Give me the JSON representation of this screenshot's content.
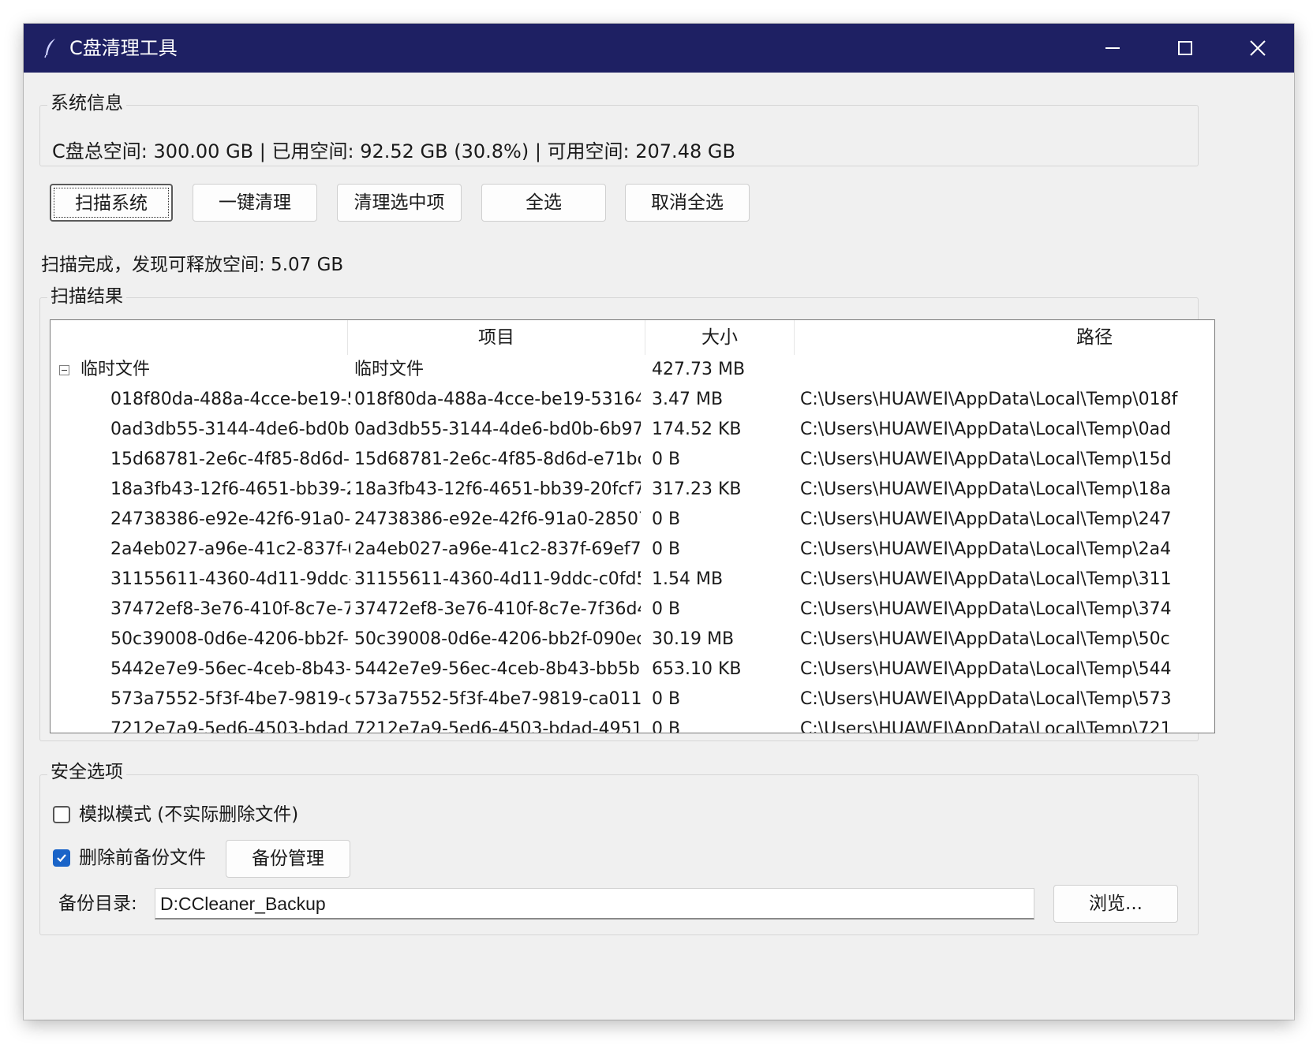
{
  "window": {
    "title": "C盘清理工具",
    "accent": "#1e2063"
  },
  "system_info": {
    "group_label": "系统信息",
    "text": "C盘总空间: 300.00 GB | 已用空间: 92.52 GB (30.8%) | 可用空间: 207.48 GB"
  },
  "toolbar": {
    "scan": "扫描系统",
    "one_click_clean": "一键清理",
    "clean_selected": "清理选中项",
    "select_all": "全选",
    "deselect_all": "取消全选"
  },
  "status": "扫描完成，发现可释放空间: 5.07 GB",
  "results": {
    "group_label": "扫描结果",
    "columns": [
      "",
      "项目",
      "大小",
      "路径"
    ],
    "parent": {
      "name": "临时文件",
      "item": "临时文件",
      "size": "427.73 MB",
      "path": ""
    },
    "rows": [
      {
        "name": "018f80da-488a-4cce-be19-5",
        "item": "018f80da-488a-4cce-be19-53164",
        "size": "3.47 MB",
        "path": "C:\\Users\\HUAWEI\\AppData\\Local\\Temp\\018f"
      },
      {
        "name": "0ad3db55-3144-4de6-bd0b",
        "item": "0ad3db55-3144-4de6-bd0b-6b97",
        "size": "174.52 KB",
        "path": "C:\\Users\\HUAWEI\\AppData\\Local\\Temp\\0ad"
      },
      {
        "name": "15d68781-2e6c-4f85-8d6d-",
        "item": "15d68781-2e6c-4f85-8d6d-e71bc",
        "size": "0 B",
        "path": "C:\\Users\\HUAWEI\\AppData\\Local\\Temp\\15d"
      },
      {
        "name": "18a3fb43-12f6-4651-bb39-2",
        "item": "18a3fb43-12f6-4651-bb39-20fcf7",
        "size": "317.23 KB",
        "path": "C:\\Users\\HUAWEI\\AppData\\Local\\Temp\\18a"
      },
      {
        "name": "24738386-e92e-42f6-91a0-2",
        "item": "24738386-e92e-42f6-91a0-28507",
        "size": "0 B",
        "path": "C:\\Users\\HUAWEI\\AppData\\Local\\Temp\\247"
      },
      {
        "name": "2a4eb027-a96e-41c2-837f-6",
        "item": "2a4eb027-a96e-41c2-837f-69ef73",
        "size": "0 B",
        "path": "C:\\Users\\HUAWEI\\AppData\\Local\\Temp\\2a4"
      },
      {
        "name": "31155611-4360-4d11-9ddc-",
        "item": "31155611-4360-4d11-9ddc-c0fd5",
        "size": "1.54 MB",
        "path": "C:\\Users\\HUAWEI\\AppData\\Local\\Temp\\311"
      },
      {
        "name": "37472ef8-3e76-410f-8c7e-7",
        "item": "37472ef8-3e76-410f-8c7e-7f36d4",
        "size": "0 B",
        "path": "C:\\Users\\HUAWEI\\AppData\\Local\\Temp\\374"
      },
      {
        "name": "50c39008-0d6e-4206-bb2f-",
        "item": "50c39008-0d6e-4206-bb2f-090ec",
        "size": "30.19 MB",
        "path": "C:\\Users\\HUAWEI\\AppData\\Local\\Temp\\50c"
      },
      {
        "name": "5442e7e9-56ec-4ceb-8b43-",
        "item": "5442e7e9-56ec-4ceb-8b43-bb5b",
        "size": "653.10 KB",
        "path": "C:\\Users\\HUAWEI\\AppData\\Local\\Temp\\544"
      },
      {
        "name": "573a7552-5f3f-4be7-9819-c",
        "item": "573a7552-5f3f-4be7-9819-ca011",
        "size": "0 B",
        "path": "C:\\Users\\HUAWEI\\AppData\\Local\\Temp\\573"
      },
      {
        "name": "7212e7a9-5ed6-4503-bdad",
        "item": "7212e7a9-5ed6-4503-bdad-4951",
        "size": "0 B",
        "path": "C:\\Users\\HUAWEI\\AppData\\Local\\Temp\\721"
      }
    ]
  },
  "safety": {
    "group_label": "安全选项",
    "simulate_label": "模拟模式 (不实际删除文件)",
    "simulate_checked": false,
    "backup_label": "删除前备份文件",
    "backup_checked": true,
    "backup_manage": "备份管理",
    "backup_dir_label": "备份目录:",
    "backup_dir_value": "D:CCleaner_Backup",
    "browse": "浏览..."
  }
}
